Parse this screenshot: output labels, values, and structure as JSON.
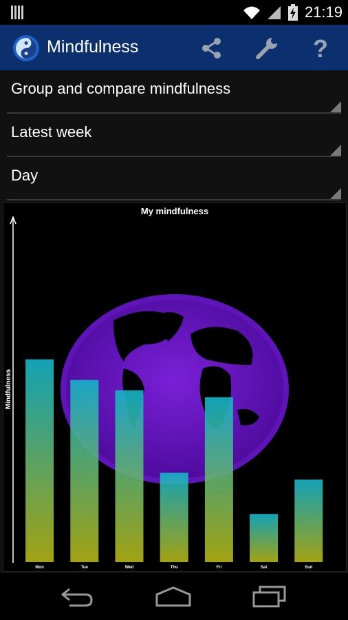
{
  "status_bar": {
    "time": "21:19",
    "icons": [
      "bars-icon",
      "wifi-icon",
      "signal-icon",
      "battery-charging-icon"
    ]
  },
  "action_bar": {
    "title": "Mindfulness",
    "icons": [
      "share-icon",
      "wrench-icon",
      "help-icon"
    ]
  },
  "spinners": [
    {
      "label": "Group and compare mindfulness"
    },
    {
      "label": "Latest week"
    },
    {
      "label": "Day"
    }
  ],
  "chart_data": {
    "type": "bar",
    "title": "My mindfulness",
    "ylabel": "Mindfulness",
    "xlabel": "",
    "categories": [
      "Mon",
      "Tue",
      "Wed",
      "Thu",
      "Fri",
      "Sat",
      "Sun"
    ],
    "values": [
      59,
      53,
      50,
      26,
      48,
      14,
      24
    ],
    "ylim": [
      0,
      100
    ],
    "grid": false,
    "gradient_colors": {
      "top": "#14b4c8",
      "bottom": "#b4b414"
    },
    "background_image": "purple-globe"
  },
  "nav_bar": {
    "icons": [
      "back-icon",
      "home-icon",
      "recent-apps-icon"
    ]
  }
}
